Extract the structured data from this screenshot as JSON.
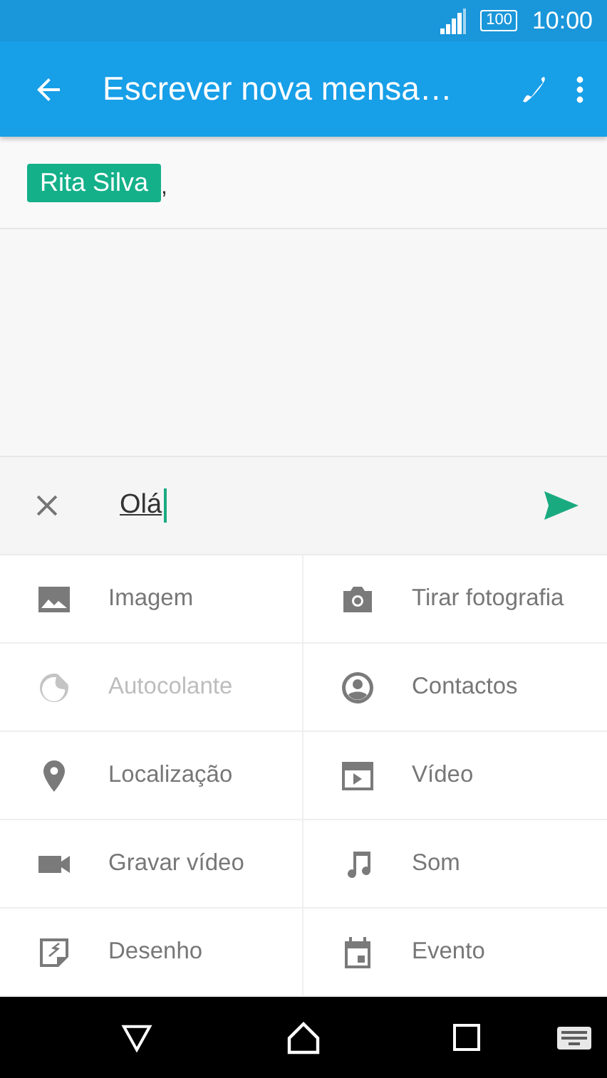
{
  "status_bar": {
    "battery": "100",
    "time": "10:00"
  },
  "app_bar": {
    "title": "Escrever nova mensa…"
  },
  "recipients": [
    {
      "name": "Rita Silva",
      "separator": ","
    }
  ],
  "compose": {
    "value": "Olá"
  },
  "attachments": [
    {
      "kind": "image",
      "label": "Imagem",
      "disabled": false
    },
    {
      "kind": "camera",
      "label": "Tirar fotografia",
      "disabled": false
    },
    {
      "kind": "sticker",
      "label": "Autocolante",
      "disabled": true
    },
    {
      "kind": "contact",
      "label": "Contactos",
      "disabled": false
    },
    {
      "kind": "location",
      "label": "Localização",
      "disabled": false
    },
    {
      "kind": "clip",
      "label": "Vídeo",
      "disabled": false
    },
    {
      "kind": "videocam",
      "label": "Gravar vídeo",
      "disabled": false
    },
    {
      "kind": "music",
      "label": "Som",
      "disabled": false
    },
    {
      "kind": "drawing",
      "label": "Desenho",
      "disabled": false
    },
    {
      "kind": "event",
      "label": "Evento",
      "disabled": false
    }
  ]
}
